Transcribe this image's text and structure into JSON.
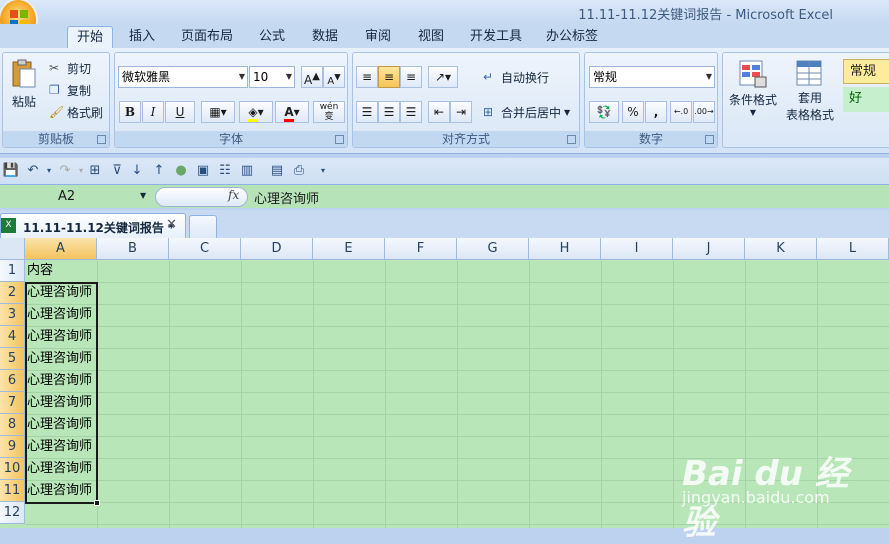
{
  "window": {
    "title": "11.11-11.12关键词报告 - Microsoft Excel"
  },
  "tabs": [
    "开始",
    "插入",
    "页面布局",
    "公式",
    "数据",
    "审阅",
    "视图",
    "开发工具",
    "办公标签"
  ],
  "ribbon": {
    "clipboard": {
      "label": "剪贴板",
      "paste": "粘贴",
      "cut": "剪切",
      "copy": "复制",
      "format_painter": "格式刷"
    },
    "font": {
      "label": "字体",
      "name": "微软雅黑",
      "size": "10",
      "bold": "B",
      "italic": "I",
      "underline": "U",
      "font_color_glyph": "A",
      "phonetic": "wén 变"
    },
    "alignment": {
      "label": "对齐方式",
      "wrap": "自动换行",
      "merge": "合并后居中"
    },
    "number": {
      "label": "数字",
      "format": "常规",
      "percent": "%",
      "comma": ","
    },
    "styles": {
      "conditional": "条件格式",
      "table_line1": "套用",
      "table_line2": "表格格式",
      "normal": "常规",
      "good": "好"
    }
  },
  "formula_bar": {
    "name_box": "A2",
    "fx": "fx",
    "content": "心理咨询师"
  },
  "workbook_tab": {
    "title": "11.11-11.12关键词报告 *",
    "close": "✕"
  },
  "columns": [
    "A",
    "B",
    "C",
    "D",
    "E",
    "F",
    "G",
    "H",
    "I",
    "J",
    "K",
    "L"
  ],
  "rows": [
    "1",
    "2",
    "3",
    "4",
    "5",
    "6",
    "7",
    "8",
    "9",
    "10",
    "11",
    "12"
  ],
  "cells": [
    "内容",
    "心理咨询师",
    "心理咨询师",
    "心理咨询师",
    "心理咨询师",
    "心理咨询师",
    "心理咨询师",
    "心理咨询师",
    "心理咨询师",
    "心理咨询师",
    "心理咨询师"
  ],
  "watermark": {
    "brand": "Bai du 经验",
    "url": "jingyan.baidu.com"
  }
}
